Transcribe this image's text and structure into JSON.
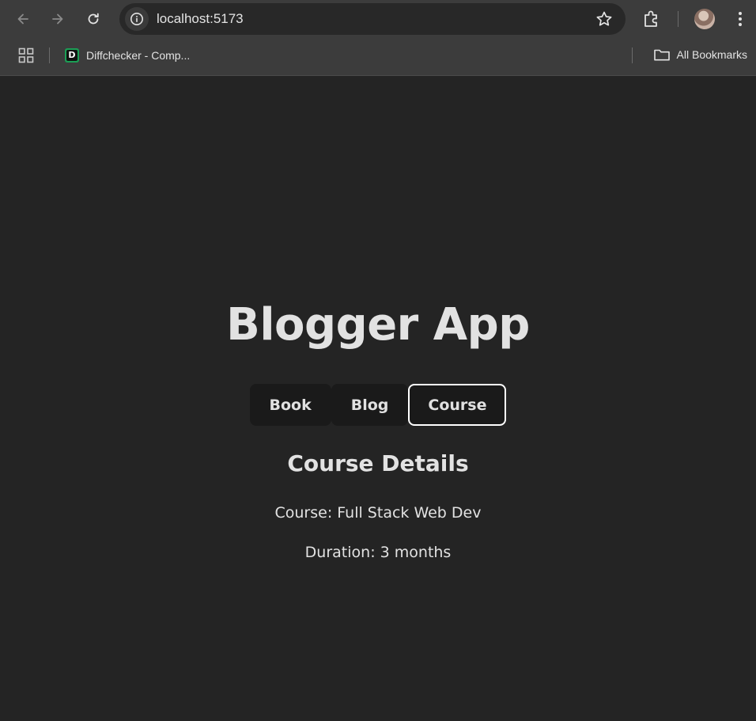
{
  "browser": {
    "url": "localhost:5173",
    "bookmarks": [
      {
        "label": "Diffchecker - Comp...",
        "favicon_letter": "D"
      }
    ],
    "all_bookmarks_label": "All Bookmarks"
  },
  "app": {
    "title": "Blogger App",
    "tabs": [
      {
        "label": "Book",
        "active": false
      },
      {
        "label": "Blog",
        "active": false
      },
      {
        "label": "Course",
        "active": true
      }
    ],
    "details": {
      "heading": "Course Details",
      "course_line": "Course: Full Stack Web Dev",
      "duration_line": "Duration: 3 months"
    }
  },
  "colors": {
    "page_background": "#242424",
    "chrome_background": "#3c3c3c",
    "button_background": "#1a1a1a",
    "active_border": "#ffffff"
  },
  "icons": [
    "back-arrow-icon",
    "forward-arrow-icon",
    "reload-icon",
    "site-info-icon",
    "bookmark-star-icon",
    "extensions-icon",
    "profile-avatar",
    "kebab-menu-icon",
    "apps-grid-icon",
    "folder-icon"
  ]
}
